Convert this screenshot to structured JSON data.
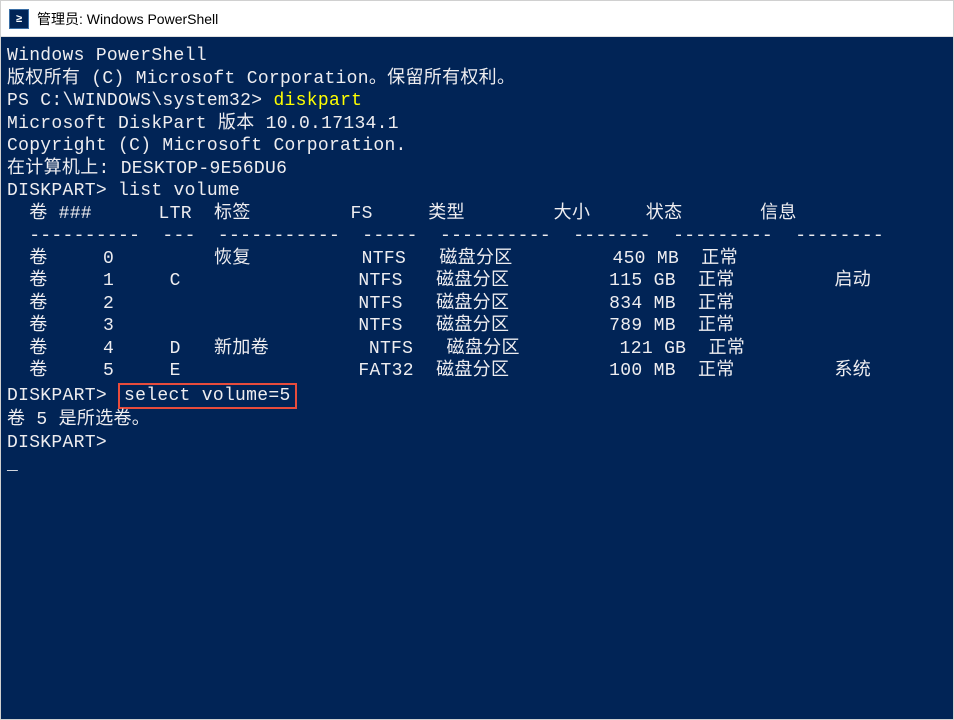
{
  "window": {
    "title": "管理员: Windows PowerShell",
    "icon_label": ">_"
  },
  "terminal": {
    "line1": "Windows PowerShell",
    "line2": "版权所有 (C) Microsoft Corporation。保留所有权利。",
    "blank1": "",
    "prompt1_prefix": "PS C:\\WINDOWS\\system32> ",
    "prompt1_cmd": "diskpart",
    "blank2": "",
    "diskpart_version": "Microsoft DiskPart 版本 10.0.17134.1",
    "blank3": "",
    "copyright": "Copyright (C) Microsoft Corporation.",
    "computer": "在计算机上: DESKTOP-9E56DU6",
    "blank4": "",
    "prompt2_prefix": "DISKPART> ",
    "prompt2_cmd": "list volume",
    "blank5": "",
    "table_header": "  卷 ###      LTR  标签         FS     类型        大小     状态       信息",
    "table_divider": "  ----------  ---  -----------  -----  ----------  -------  ---------  --------",
    "row0": "  卷     0         恢复          NTFS   磁盘分区         450 MB  正常",
    "row1": "  卷     1     C                NTFS   磁盘分区         115 GB  正常         启动",
    "row2": "  卷     2                      NTFS   磁盘分区         834 MB  正常",
    "row3": "  卷     3                      NTFS   磁盘分区         789 MB  正常",
    "row4": "  卷     4     D   新加卷         NTFS   磁盘分区         121 GB  正常",
    "row5": "  卷     5     E                FAT32  磁盘分区         100 MB  正常         系统",
    "blank6": "",
    "prompt3_prefix": "DISKPART> ",
    "prompt3_cmd": "select volume=5",
    "blank7": "",
    "selected": "卷 5 是所选卷。",
    "blank8": "",
    "prompt4": "DISKPART>",
    "cursor": "_"
  }
}
